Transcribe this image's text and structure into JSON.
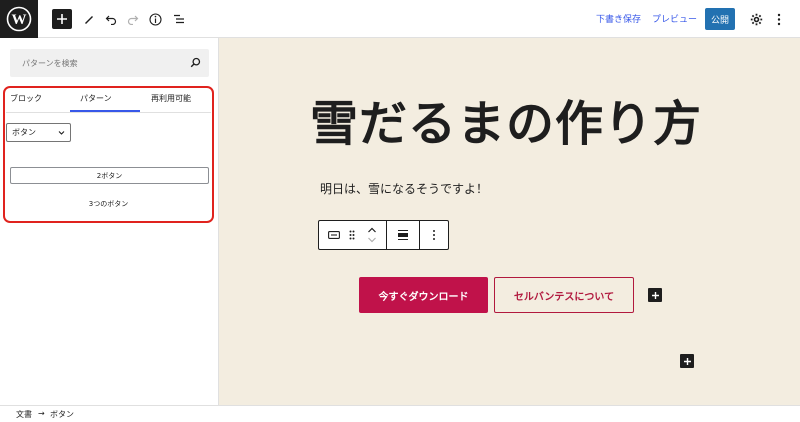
{
  "toolbar": {
    "save_draft": "下書き保存",
    "preview": "プレビュー",
    "publish": "公開"
  },
  "sidebar": {
    "search_placeholder": "パターンを検索",
    "tabs": [
      "ブロック",
      "パターン",
      "再利用可能"
    ],
    "active_tab": "パターン",
    "category_select": "ボタン",
    "pattern_buttons_label": "2ボタン",
    "pattern_three_label": "3つのボタン"
  },
  "editor": {
    "heading": "雪だるまの作り方",
    "paragraph": "明日は、雪になるそうですよ！",
    "buttons": [
      "今すぐダウンロード",
      "セルバンテスについて"
    ]
  },
  "breadcrumb": {
    "items": [
      "文書",
      "ボタン"
    ]
  },
  "colors": {
    "accent": "#3858e9",
    "publish": "#2271b1",
    "canvas_bg": "#f3ede0",
    "button_primary": "#c0124a",
    "highlight_frame": "#e0231e"
  },
  "icons": [
    "wordpress-logo-icon",
    "plus-icon",
    "pencil-icon",
    "undo-icon",
    "redo-icon",
    "info-icon",
    "list-view-icon",
    "gear-icon",
    "more-vertical-icon",
    "search-icon",
    "chevron-down-icon",
    "button-block-icon",
    "drag-handle-icon",
    "chevron-up-icon",
    "justify-icon"
  ]
}
